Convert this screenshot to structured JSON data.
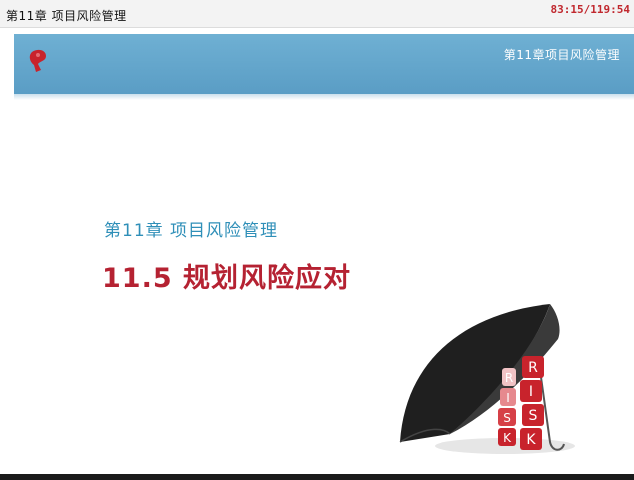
{
  "window": {
    "title": "第11章 项目风险管理",
    "timer": "83:15/119:54"
  },
  "slide": {
    "banner_title": "第11章项目风险管理",
    "chapter": "第11章 项目风险管理",
    "section": "11.5  规划风险应对",
    "illustration": {
      "icon": "umbrella-risk-blocks",
      "block_letters_right": [
        "R",
        "I",
        "S",
        "K"
      ],
      "block_letters_left": [
        "R",
        "I",
        "S",
        "K"
      ]
    }
  },
  "colors": {
    "banner": "#64a7cc",
    "chapter_text": "#2f8fb8",
    "section_text": "#b52232",
    "block_red": "#c8232c"
  }
}
